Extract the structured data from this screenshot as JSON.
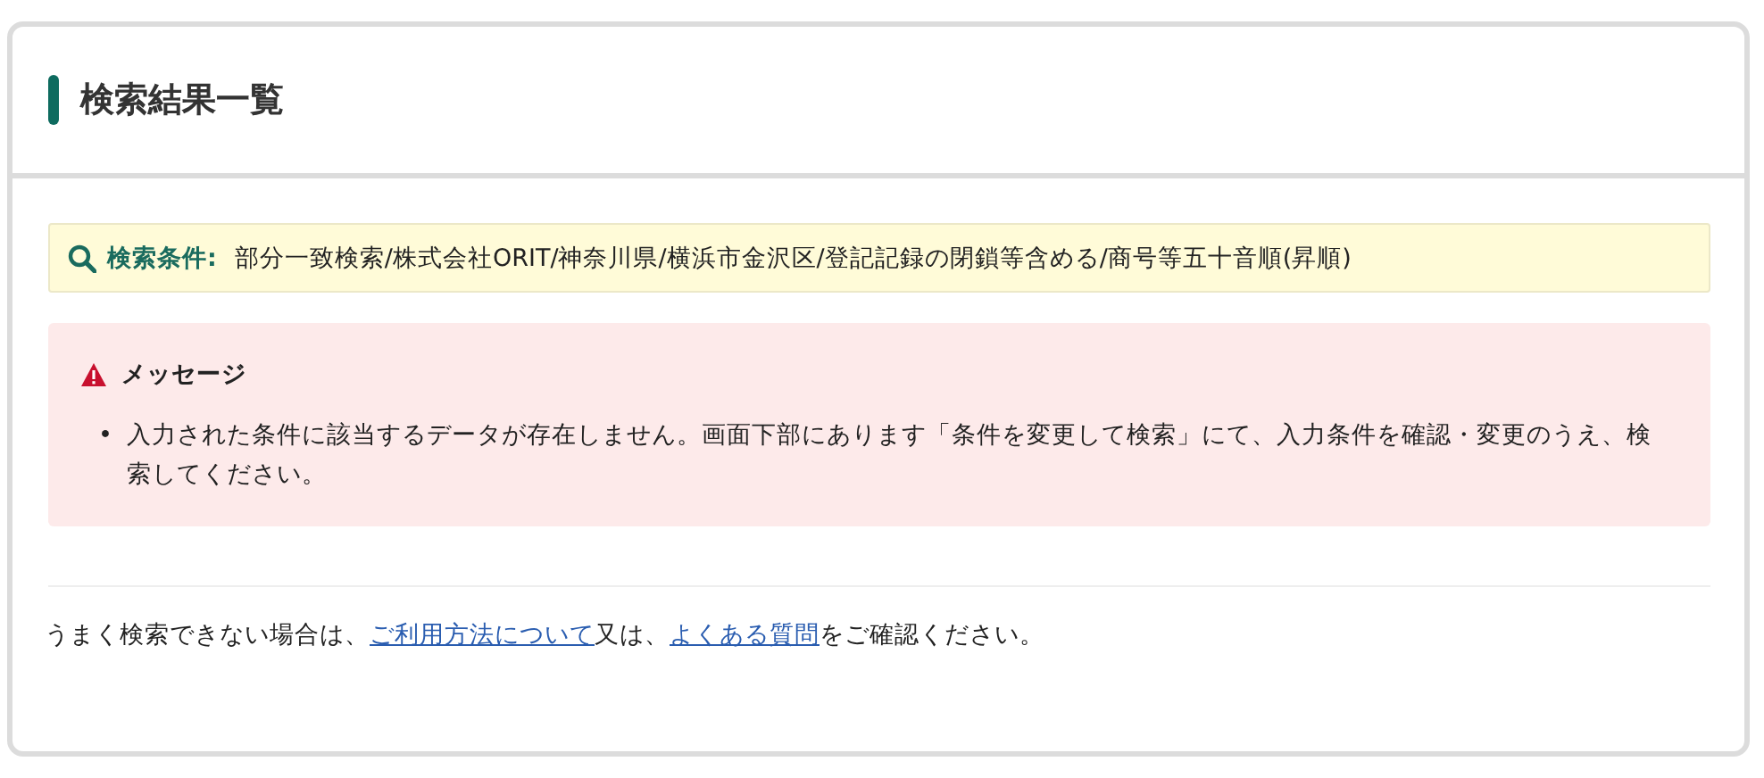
{
  "title": "検索結果一覧",
  "condition": {
    "label": "検索条件:",
    "value": "部分一致検索/株式会社ORIT/神奈川県/横浜市金沢区/登記記録の閉鎖等含める/商号等五十音順(昇順)"
  },
  "message": {
    "title": "メッセージ",
    "bullet": "•",
    "items": [
      "入力された条件に該当するデータが存在しません。画面下部にあります「条件を変更して検索」にて、入力条件を確認・変更のうえ、検索してください。"
    ]
  },
  "footer": [
    {
      "kind": "text",
      "text": "うまく検索できない場合は、"
    },
    {
      "kind": "link",
      "text": "ご利用方法について"
    },
    {
      "kind": "text",
      "text": "又は、"
    },
    {
      "kind": "link",
      "text": "よくある質問"
    },
    {
      "kind": "text",
      "text": "をご確認ください。"
    }
  ]
}
